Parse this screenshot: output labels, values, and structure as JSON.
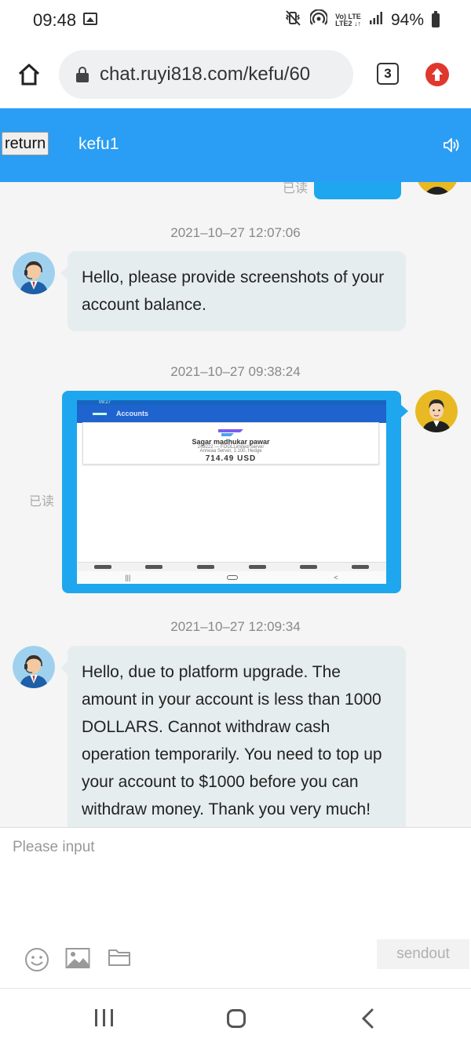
{
  "status_bar": {
    "time": "09:48",
    "network_label_top": "Vo) LTE",
    "network_label_bottom": "LTE2 ↓↑",
    "battery": "94%",
    "icons": [
      "image-icon",
      "mute-vibrate-icon",
      "hotspot-icon",
      "signal-icon",
      "battery-icon"
    ]
  },
  "browser": {
    "url": "chat.ruyi818.com/kefu/60",
    "tab_count": "3",
    "icons": [
      "home-icon",
      "lock-icon",
      "tabs-icon",
      "upload-icon"
    ]
  },
  "chat_header": {
    "return_label": "return",
    "title": "kefu1",
    "color": "#2a9df4"
  },
  "messages": [
    {
      "timestamp": "2021–10–27 12:07:06",
      "sender": "agent",
      "text": "Hello, please provide screenshots of your account balance."
    },
    {
      "timestamp": "2021–10–27 09:38:24",
      "sender": "user",
      "read_label": "已读",
      "image": {
        "screen_title": "Accounts",
        "account_name": "Sagar madhukar pawar",
        "account_sub": "248222 — FOGLLimited-Server",
        "account_sub2": "Anneaa Server, 1:100, Hedge",
        "balance": "714.49 USD",
        "status_time": "09:27"
      }
    },
    {
      "timestamp": "2021–10–27 12:09:34",
      "sender": "agent",
      "text": "Hello, due to platform upgrade. The amount in your account is less than 1000 DOLLARS. Cannot withdraw cash operation temporarily. You need to top up your account to $1000 before you can withdraw money. Thank you very much!"
    }
  ],
  "top_read_label": "已读",
  "composer": {
    "placeholder": "Please input",
    "send_label": "sendout",
    "tools": [
      "emoji-icon",
      "image-upload-icon",
      "folder-icon"
    ]
  },
  "colors": {
    "accent": "#2a9df4",
    "user_bubble": "#1ea7ee",
    "agent_bubble": "#e6edee"
  }
}
